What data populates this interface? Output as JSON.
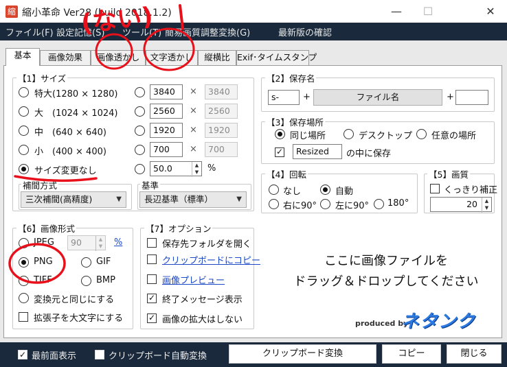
{
  "window": {
    "title": "縮小革命 Ver28 (build 2018.1.2)",
    "app_icon_glyph": "縮",
    "min_glyph": "—",
    "max_glyph": "☐",
    "close_glyph": "✕"
  },
  "menu": [
    "ファイル(F)",
    "設定記憶(S)",
    "ツール(T)",
    "簡易画質調整変換(G)",
    "最新版の確認"
  ],
  "tabs": [
    "基本",
    "画像効果",
    "画像透かし",
    "文字透かし",
    "縦横比",
    "Exif･タイムスタンプ"
  ],
  "size_group": {
    "label": "【1】サイズ",
    "presets": [
      {
        "label": "特大(1280 × 1280)",
        "width": "3840",
        "height": "3840"
      },
      {
        "label": "大　(1024 × 1024)",
        "width": "2560",
        "height": "2560"
      },
      {
        "label": "中　(640 × 640)",
        "width": "1920",
        "height": "1920"
      },
      {
        "label": "小　(400 × 400)",
        "width": "700",
        "height": "700"
      }
    ],
    "times": "×",
    "no_change_label": "サイズ変更なし",
    "percent_value": "50.0",
    "percent_unit": "%"
  },
  "interp": {
    "label": "補間方式",
    "value": "三次補間(高精度)"
  },
  "base": {
    "label": "基準",
    "value": "長辺基準（標準）"
  },
  "save_name": {
    "label": "【2】保存名",
    "prefix": "s-",
    "plus1": "+",
    "filename_button": "ファイル名",
    "plus2": "+",
    "suffix": ""
  },
  "save_place": {
    "label": "【3】保存場所",
    "options": [
      "同じ場所",
      "デスクトップ",
      "任意の場所"
    ],
    "folder_value": "Resized",
    "folder_suffix": "の中に保存"
  },
  "rotate": {
    "label": "【4】回転",
    "options": [
      "なし",
      "自動",
      "右に90°",
      "左に90°",
      "180°"
    ]
  },
  "quality": {
    "label": "【5】画質",
    "sharp_label": "くっきり補正",
    "value": "20"
  },
  "format": {
    "label": "【6】画像形式",
    "jpeg": "JPEG",
    "jpeg_quality": "90",
    "percent_link": "%",
    "png": "PNG",
    "gif": "GIF",
    "tiff": "TIFF",
    "bmp": "BMP",
    "same_as_source": "変換元と同じにする",
    "uppercase_ext": "拡張子を大文字にする"
  },
  "options": {
    "label": "【7】オプション",
    "open_folder": "保存先フォルダを開く",
    "copy_clipboard": "クリップボードにコピー",
    "preview": "画像プレビュー",
    "finish_msg": "終了メッセージ表示",
    "no_enlarge": "画像の拡大はしない"
  },
  "dropzone": {
    "line1": "ここに画像ファイルを",
    "line2": "ドラッグ＆ドロップしてください"
  },
  "brand": {
    "produced_by": "produced by",
    "name": "ネタンク"
  },
  "bottom": {
    "topmost": "最前面表示",
    "clip_auto": "クリップボード自動変換",
    "clip_convert": "クリップボード変換",
    "copy": "コピー",
    "close": "閉じる"
  },
  "annotation": {
    "text": "(ない)",
    "color": "#e8101a"
  },
  "colors": {
    "chrome": "#1a2a3c",
    "link": "#1a47c6",
    "brand": "#2c7ae0"
  }
}
